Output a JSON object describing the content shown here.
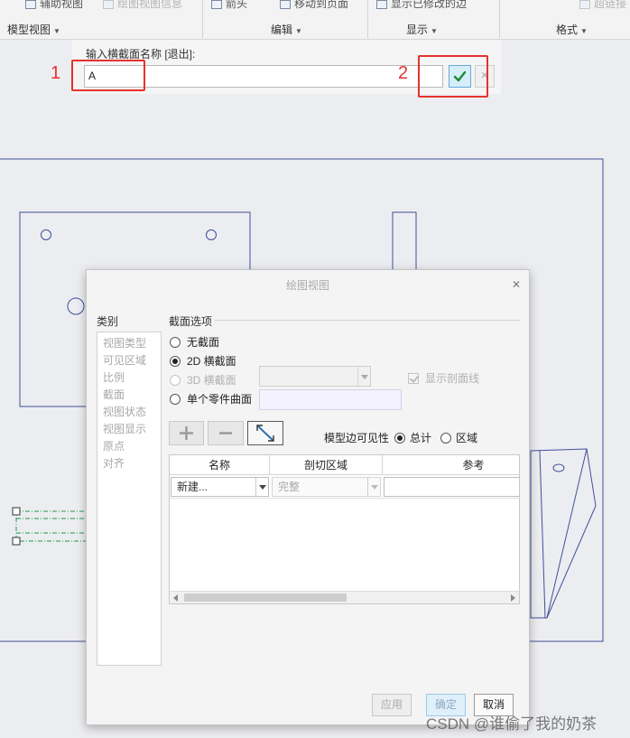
{
  "toolbar": {
    "top_items": [
      "辅助视图",
      "绘图视图信息",
      "箭头",
      "移动到页面",
      "显示已修改的边",
      "超链接"
    ],
    "groups": [
      "模型视图",
      "编辑",
      "显示",
      "格式"
    ]
  },
  "name_prompt": {
    "label": "输入横截面名称 [退出]:",
    "value": "A",
    "confirm_icon": "check-icon",
    "cancel_icon": "close-icon"
  },
  "annotations": {
    "marker_1": "1",
    "marker_2": "2",
    "marker_color": "#e5322d"
  },
  "dialog": {
    "title": "绘图视图",
    "close_icon": "close-icon",
    "category_label": "类别",
    "categories": [
      "视图类型",
      "可见区域",
      "比例",
      "截面",
      "视图状态",
      "视图显示",
      "原点",
      "对齐"
    ],
    "section_options_label": "截面选项",
    "options": {
      "none": "无截面",
      "2d": "2D 横截面",
      "3d": "3D 横截面",
      "surface": "单个零件曲面"
    },
    "selected_option": "2D 横截面",
    "show_hatch_label": "显示剖面线",
    "show_hatch_checked": true,
    "edge_visibility_label": "模型边可见性",
    "edge_visibility_options": [
      "总计",
      "区域"
    ],
    "edge_visibility_selected": "总计",
    "table": {
      "columns": [
        "名称",
        "剖切区域",
        "参考"
      ],
      "row_name": "新建...",
      "row_area": "完整"
    },
    "buttons": {
      "apply": "应用",
      "ok": "确定",
      "cancel": "取消"
    }
  },
  "watermark": "CSDN @谁偷了我的奶茶",
  "colors": {
    "accent": "#64a9d6",
    "check_green": "#1f8a3a",
    "drawing_line": "#3f4f9a",
    "canvas": "#ecedf0"
  }
}
